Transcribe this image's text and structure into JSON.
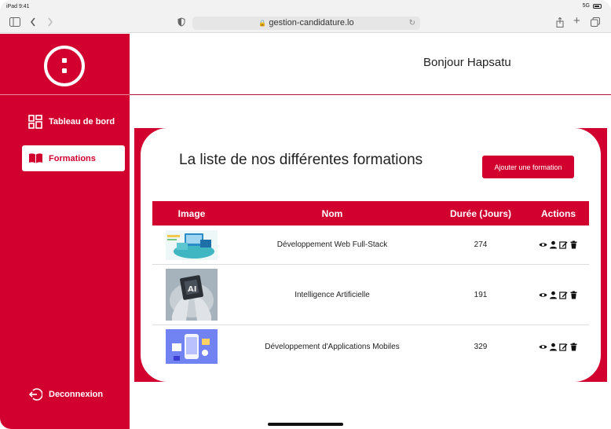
{
  "status_bar": {
    "time": "iPad 9:41",
    "signal": "5G"
  },
  "browser": {
    "url": "gestion-candidature.lo"
  },
  "sidebar": {
    "items": [
      {
        "label": "Tableau de bord",
        "icon": "dashboard-grid-icon"
      },
      {
        "label": "Formations",
        "icon": "book-icon",
        "active": true
      }
    ],
    "logout_label": "Deconnexion"
  },
  "header": {
    "greeting": "Bonjour Hapsatu"
  },
  "main": {
    "title": "La liste de nos différentes formations",
    "add_button": "Ajouter une formation",
    "table": {
      "columns": [
        "Image",
        "Nom",
        "Durée (Jours)",
        "Actions"
      ],
      "rows": [
        {
          "nom": "Développement Web Full-Stack",
          "duree": "274"
        },
        {
          "nom": "Intelligence Artificielle",
          "duree": "191"
        },
        {
          "nom": "Développement d'Applications Mobiles",
          "duree": "329"
        }
      ]
    }
  },
  "colors": {
    "brand": "#d1002f"
  }
}
